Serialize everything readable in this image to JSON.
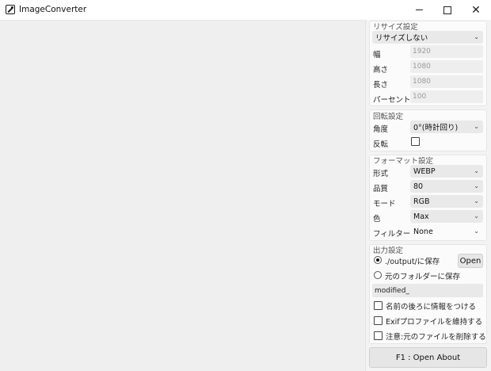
{
  "window": {
    "title": "ImageConverter",
    "minimize": "",
    "maximize": "",
    "close": "✕"
  },
  "resize": {
    "title": "リサイズ設定",
    "mode": "リサイズしない",
    "fields": [
      {
        "label": "幅",
        "value": "1920"
      },
      {
        "label": "高さ",
        "value": "1080"
      },
      {
        "label": "長さ",
        "value": "1080"
      },
      {
        "label": "パーセント",
        "value": "100"
      }
    ]
  },
  "rotate": {
    "title": "回転設定",
    "angle_label": "角度",
    "angle_value": "0°(時計回り)",
    "flip_label": "反転"
  },
  "format": {
    "title": "フォーマット設定",
    "rows": [
      {
        "label": "形式",
        "value": "WEBP"
      },
      {
        "label": "品質",
        "value": "80"
      },
      {
        "label": "モード",
        "value": "RGB"
      },
      {
        "label": "色",
        "value": "Max"
      },
      {
        "label": "フィルター",
        "value": "None"
      }
    ]
  },
  "output": {
    "title": "出力設定",
    "radio1": "./output/に保存",
    "radio2": "元のフォルダーに保存",
    "open_button": "Open",
    "suffix": "modified_",
    "options": [
      "名前の後ろに情報をつける",
      "Exifプロファイルを維持する",
      "注意:元のファイルを削除する"
    ]
  },
  "about_button": "F1 : Open About"
}
